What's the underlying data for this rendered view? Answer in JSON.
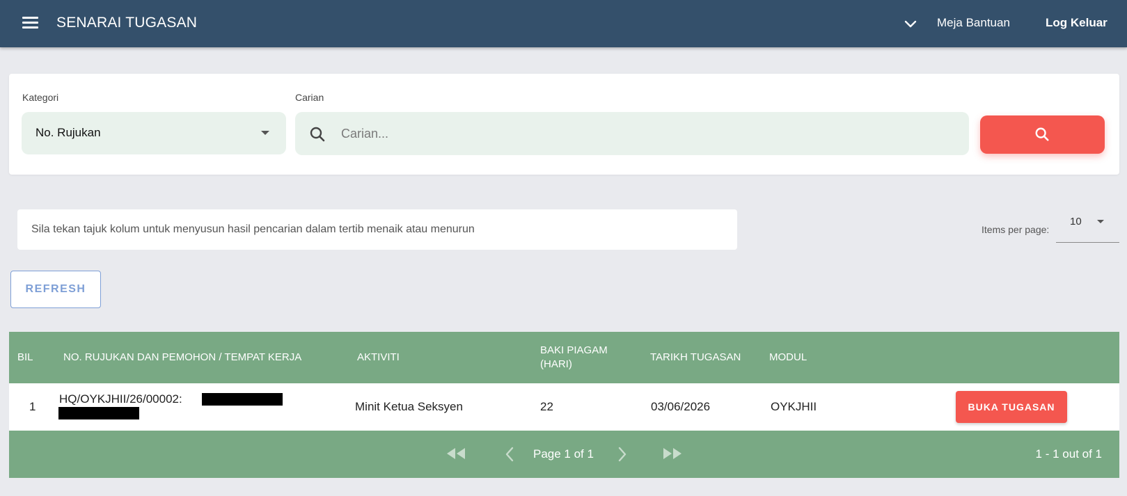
{
  "header": {
    "title": "SENARAI TUGASAN",
    "help_label": "Meja Bantuan",
    "logout_label": "Log Keluar"
  },
  "search": {
    "category_label": "Kategori",
    "category_value": "No. Rujukan",
    "search_label": "Carian",
    "search_placeholder": "Carian...",
    "search_value": ""
  },
  "hint": "Sila tekan tajuk kolum untuk menyusun hasil pencarian dalam tertib menaik atau menurun",
  "pagination_size": {
    "label": "Items per page:",
    "value": "10"
  },
  "refresh_label": "REFRESH",
  "table": {
    "columns": {
      "bil": "BIL",
      "no_rujukan": "NO. RUJUKAN DAN PEMOHON / TEMPAT KERJA",
      "aktiviti": "AKTIVITI",
      "baki_line1": "BAKI PIAGAM",
      "baki_line2": "(HARI)",
      "tarikh": "TARIKH TUGASAN",
      "modul": "MODUL"
    },
    "rows": [
      {
        "bil": "1",
        "no_rujukan": "HQ/OYKJHII/26/00002:",
        "aktiviti": "Minit Ketua Seksyen",
        "baki": "22",
        "tarikh": "03/06/2026",
        "modul": "OYKJHII",
        "action_label": "BUKA TUGASAN"
      }
    ]
  },
  "pager": {
    "page_text": "Page 1 of 1",
    "range_text": "1 - 1 out of 1"
  },
  "colors": {
    "topbar": "#34506b",
    "accent_red": "#f4574f",
    "table_green": "#79a984",
    "field_bg": "#e9f2ec",
    "refresh_blue": "#7e9fd6"
  }
}
